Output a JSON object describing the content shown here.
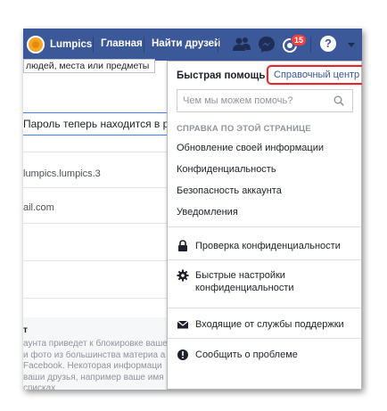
{
  "topbar": {
    "profile_name": "Lumpics",
    "home_label": "Главная",
    "find_friends_label": "Найти друзей",
    "notifications_count": "15",
    "help_glyph": "?",
    "icons": [
      "friends-icon",
      "messenger-icon",
      "notifications-icon",
      "help-icon",
      "caret-down-icon"
    ],
    "color": "#3b5998"
  },
  "search_tooltip": "людей, места или предметы",
  "background": {
    "input_text": "Пароль теперь находится в раз",
    "row1": "lumpics.lumpics.3",
    "row2": "ail.com",
    "bottom_title": "т",
    "bottom_text": "аунта приведет к блокировке ваше и фото из большинства материа а Facebook. Некоторая информаци ваши друзья, например ваше имя в списках"
  },
  "dropdown": {
    "title": "Быстрая помощь",
    "help_center_link": "Справочный центр",
    "search_placeholder": "Чем мы можем помочь?",
    "section_title": "СПРАВКА ПО ЭТОЙ СТРАНИЦЕ",
    "links": [
      "Обновление своей информации",
      "Конфиденциальность",
      "Безопасность аккаунта",
      "Уведомления"
    ],
    "actions": {
      "privacy_check": "Проверка конфиденциальности",
      "quick_settings": "Быстрые настройки конфиденциальности",
      "support_inbox": "Входящие от службы поддержки",
      "report_problem": "Сообщить о проблеме"
    },
    "highlight_color": "#e0282e"
  }
}
